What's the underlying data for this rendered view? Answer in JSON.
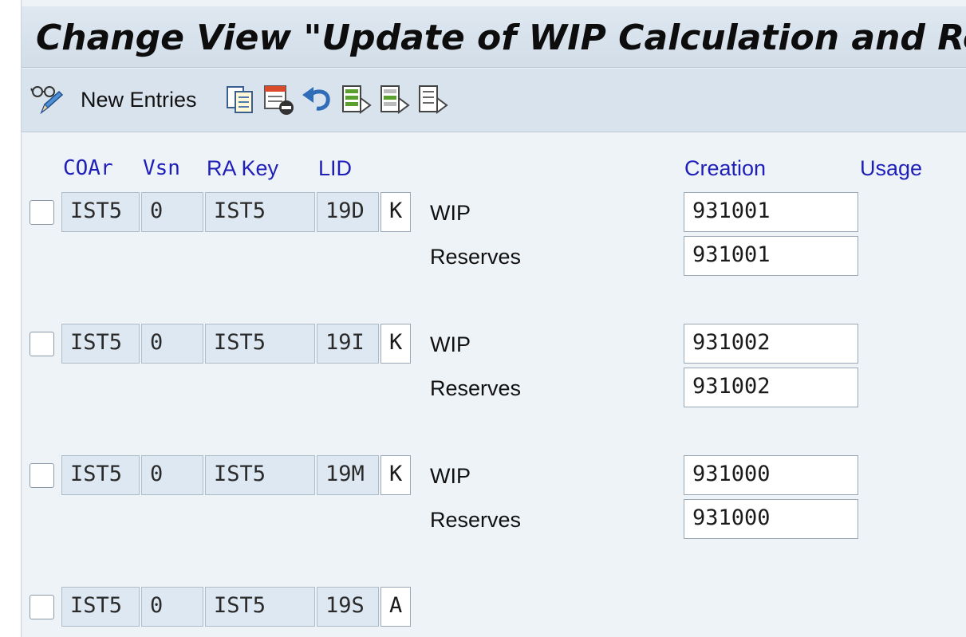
{
  "title": "Change View \"Update of WIP Calculation and Resul",
  "toolbar": {
    "new_entries": "New Entries"
  },
  "headers": {
    "coar": "COAr",
    "vsn": "Vsn",
    "ra_key": "RA Key",
    "lid": "LID",
    "creation": "Creation",
    "usage": "Usage"
  },
  "labels": {
    "wip": "WIP",
    "reserves": "Reserves"
  },
  "rows": [
    {
      "coar": "IST5",
      "vsn": "0",
      "ra_key": "IST5",
      "lid": "19D",
      "type": "K",
      "wip": "931001",
      "reserves": "931001"
    },
    {
      "coar": "IST5",
      "vsn": "0",
      "ra_key": "IST5",
      "lid": "19I",
      "type": "K",
      "wip": "931002",
      "reserves": "931002"
    },
    {
      "coar": "IST5",
      "vsn": "0",
      "ra_key": "IST5",
      "lid": "19M",
      "type": "K",
      "wip": "931000",
      "reserves": "931000"
    },
    {
      "coar": "IST5",
      "vsn": "0",
      "ra_key": "IST5",
      "lid": "19S",
      "type": "A"
    }
  ]
}
